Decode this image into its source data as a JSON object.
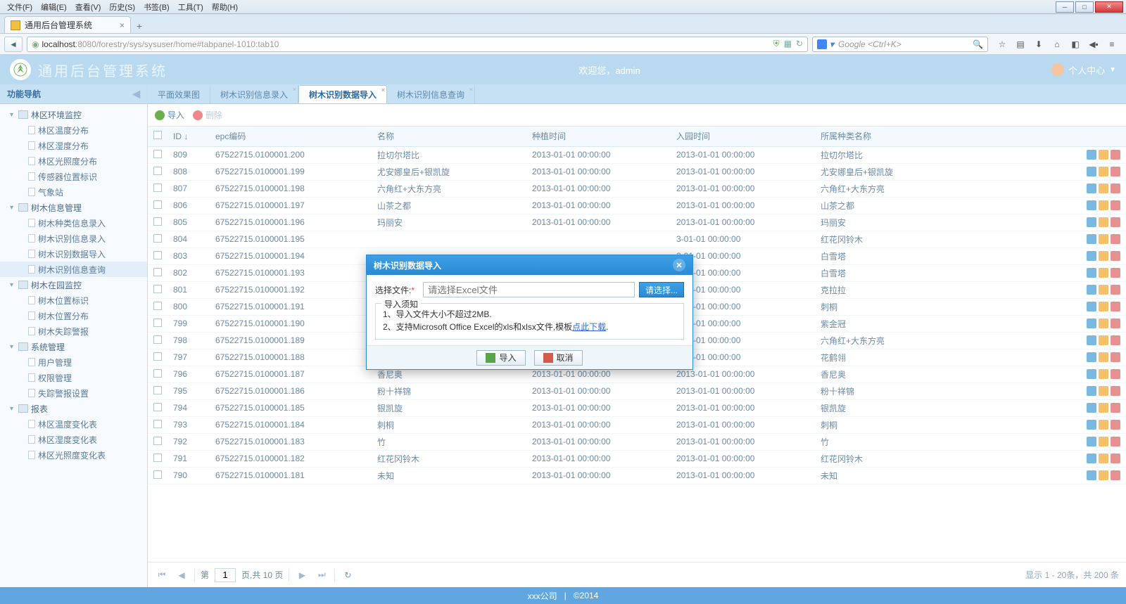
{
  "os_menu": [
    "文件(F)",
    "编辑(E)",
    "查看(V)",
    "历史(S)",
    "书签(B)",
    "工具(T)",
    "帮助(H)"
  ],
  "browser_tab": {
    "title": "通用后台管理系统"
  },
  "url": {
    "host": "localhost",
    "port_path": ":8080/forestry/sys/sysuser/home#tabpanel-1010:tab10"
  },
  "search_placeholder": "Google <Ctrl+K>",
  "app": {
    "title": "通用后台管理系统",
    "welcome": "欢迎您，admin",
    "user_center": "个人中心"
  },
  "sidebar": {
    "title": "功能导航",
    "groups": [
      {
        "label": "林区环境监控",
        "children": [
          "林区温度分布",
          "林区湿度分布",
          "林区光照度分布",
          "传感器位置标识",
          "气象站"
        ]
      },
      {
        "label": "树木信息管理",
        "children": [
          "树木种类信息录入",
          "树木识别信息录入",
          "树木识别数据导入",
          "树木识别信息查询"
        ],
        "active_index": 3
      },
      {
        "label": "树木在园监控",
        "children": [
          "树木位置标识",
          "树木位置分布",
          "树木失踪警报"
        ]
      },
      {
        "label": "系统管理",
        "children": [
          "用户管理",
          "权限管理",
          "失踪警报设置"
        ]
      },
      {
        "label": "报表",
        "children": [
          "林区温度变化表",
          "林区湿度变化表",
          "林区光照度变化表"
        ]
      }
    ]
  },
  "tabs": [
    {
      "label": "平面效果图",
      "closable": false
    },
    {
      "label": "树木识别信息录入",
      "closable": true
    },
    {
      "label": "树木识别数据导入",
      "closable": true,
      "active": true
    },
    {
      "label": "树木识别信息查询",
      "closable": true
    }
  ],
  "toolbar": {
    "import": "导入",
    "delete": "删除"
  },
  "columns": [
    "",
    "ID ↓",
    "epc编码",
    "名称",
    "种植时间",
    "入园时间",
    "所属种类名称",
    ""
  ],
  "rows": [
    {
      "id": "809",
      "epc": "67522715.0100001.200",
      "name": "拉切尔塔比",
      "plant": "2013-01-01 00:00:00",
      "enter": "2013-01-01 00:00:00",
      "kind": "拉切尔塔比"
    },
    {
      "id": "808",
      "epc": "67522715.0100001.199",
      "name": "尤安娜皇后+银凯旋",
      "plant": "2013-01-01 00:00:00",
      "enter": "2013-01-01 00:00:00",
      "kind": "尤安娜皇后+银凯旋"
    },
    {
      "id": "807",
      "epc": "67522715.0100001.198",
      "name": "六角红+大东方亮",
      "plant": "2013-01-01 00:00:00",
      "enter": "2013-01-01 00:00:00",
      "kind": "六角红+大东方亮"
    },
    {
      "id": "806",
      "epc": "67522715.0100001.197",
      "name": "山茶之都",
      "plant": "2013-01-01 00:00:00",
      "enter": "2013-01-01 00:00:00",
      "kind": "山茶之都"
    },
    {
      "id": "805",
      "epc": "67522715.0100001.196",
      "name": "玛丽安",
      "plant": "2013-01-01 00:00:00",
      "enter": "2013-01-01 00:00:00",
      "kind": "玛丽安"
    },
    {
      "id": "804",
      "epc": "67522715.0100001.195",
      "name": "",
      "plant": "",
      "enter": "3-01-01 00:00:00",
      "kind": "红花冈铃木"
    },
    {
      "id": "803",
      "epc": "67522715.0100001.194",
      "name": "",
      "plant": "",
      "enter": "3-01-01 00:00:00",
      "kind": "白雪塔"
    },
    {
      "id": "802",
      "epc": "67522715.0100001.193",
      "name": "",
      "plant": "",
      "enter": "3-01-01 00:00:00",
      "kind": "白雪塔"
    },
    {
      "id": "801",
      "epc": "67522715.0100001.192",
      "name": "",
      "plant": "",
      "enter": "3-01-01 00:00:00",
      "kind": "克拉拉"
    },
    {
      "id": "800",
      "epc": "67522715.0100001.191",
      "name": "",
      "plant": "",
      "enter": "3-01-01 00:00:00",
      "kind": "刺桐"
    },
    {
      "id": "799",
      "epc": "67522715.0100001.190",
      "name": "",
      "plant": "",
      "enter": "3-01-01 00:00:00",
      "kind": "紫金冠"
    },
    {
      "id": "798",
      "epc": "67522715.0100001.189",
      "name": "",
      "plant": "",
      "enter": "3-01-01 00:00:00",
      "kind": "六角红+大东方亮"
    },
    {
      "id": "797",
      "epc": "67522715.0100001.188",
      "name": "",
      "plant": "",
      "enter": "3-01-01 00:00:00",
      "kind": "花鹤翎"
    },
    {
      "id": "796",
      "epc": "67522715.0100001.187",
      "name": "香尼奥",
      "plant": "2013-01-01 00:00:00",
      "enter": "2013-01-01 00:00:00",
      "kind": "香尼奥"
    },
    {
      "id": "795",
      "epc": "67522715.0100001.186",
      "name": "粉十祥锦",
      "plant": "2013-01-01 00:00:00",
      "enter": "2013-01-01 00:00:00",
      "kind": "粉十祥锦"
    },
    {
      "id": "794",
      "epc": "67522715.0100001.185",
      "name": "银凯旋",
      "plant": "2013-01-01 00:00:00",
      "enter": "2013-01-01 00:00:00",
      "kind": "银凯旋"
    },
    {
      "id": "793",
      "epc": "67522715.0100001.184",
      "name": "刺桐",
      "plant": "2013-01-01 00:00:00",
      "enter": "2013-01-01 00:00:00",
      "kind": "刺桐"
    },
    {
      "id": "792",
      "epc": "67522715.0100001.183",
      "name": "竹",
      "plant": "2013-01-01 00:00:00",
      "enter": "2013-01-01 00:00:00",
      "kind": "竹"
    },
    {
      "id": "791",
      "epc": "67522715.0100001.182",
      "name": "红花冈铃木",
      "plant": "2013-01-01 00:00:00",
      "enter": "2013-01-01 00:00:00",
      "kind": "红花冈铃木"
    },
    {
      "id": "790",
      "epc": "67522715.0100001.181",
      "name": "未知",
      "plant": "2013-01-01 00:00:00",
      "enter": "2013-01-01 00:00:00",
      "kind": "未知"
    }
  ],
  "pager": {
    "page_label_prefix": "第",
    "page": "1",
    "page_label_suffix": "页,共 10 页",
    "info": "显示 1 - 20条，共 200 条"
  },
  "footer": {
    "company": "xxx公司",
    "sep": "|",
    "copy": "©2014"
  },
  "modal": {
    "title": "树木识别数据导入",
    "file_label": "选择文件:",
    "placeholder": "请选择Excel文件",
    "browse": "请选择...",
    "legend": "导入须知",
    "rule1": "1、导入文件大小不超过2MB.",
    "rule2_prefix": "2、支持Microsoft Office Excel的xls和xlsx文件,模板",
    "rule2_link": "点此下载",
    "rule2_suffix": ".",
    "ok": "导入",
    "cancel": "取消"
  }
}
